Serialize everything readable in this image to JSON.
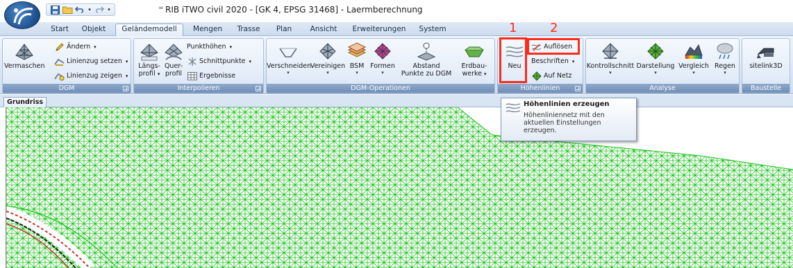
{
  "window": {
    "title": "RIB iTWO civil 2020 - [GK 4, EPSG 31468] - Laermberechnung",
    "qat_separator": "="
  },
  "tabs": [
    {
      "label": "Start"
    },
    {
      "label": "Objekt"
    },
    {
      "label": "Geländemodell",
      "active": true
    },
    {
      "label": "Mengen"
    },
    {
      "label": "Trasse"
    },
    {
      "label": "Plan"
    },
    {
      "label": "Ansicht"
    },
    {
      "label": "Erweiterungen"
    },
    {
      "label": "System"
    }
  ],
  "ribbon": {
    "dgm": {
      "label": "DGM",
      "vermaschen": "Vermaschen",
      "aendern": "Ändern",
      "linienzug_setzen": "Linienzug setzen",
      "linienzug_zeigen": "Linienzug zeigen"
    },
    "interpolieren": {
      "label": "Interpolieren",
      "laengs_line1": "Längs-",
      "laengs_line2": "profil",
      "quer_line1": "Quer-",
      "quer_line2": "profil",
      "punkthoehen": "Punkthöhen",
      "schnittpunkte": "Schnittpunkte",
      "ergebnisse": "Ergebnisse"
    },
    "dgm_operationen": {
      "label": "DGM-Operationen",
      "verschneiden": "Verschneiden",
      "vereinigen": "Vereinigen",
      "bsm": "BSM",
      "formen": "Formen",
      "abstand_line1": "Abstand",
      "abstand_line2": "Punkte zu DGM",
      "erdbau_line1": "Erdbau-",
      "erdbau_line2": "werke"
    },
    "hoehenlinien": {
      "label": "Höhenlinien",
      "neu": "Neu",
      "aufloesen": "Auflösen",
      "beschriften": "Beschriften",
      "auf_netz": "Auf Netz"
    },
    "analyse": {
      "label": "Analyse",
      "kontrollschnitt": "Kontrollschnitt",
      "darstellung": "Darstellung",
      "vergleich": "Vergleich",
      "regen": "Regen"
    },
    "baustelle": {
      "label": "Baustelle",
      "sitelink": "sitelink3D"
    }
  },
  "annotations": {
    "num1": "1",
    "num2": "2",
    "color": "#ff2a1a"
  },
  "tooltip": {
    "title": "Höhenlinien erzeugen",
    "body": "Höhenliniennetz mit den aktuellen Einstellungen erzeugen."
  },
  "document": {
    "tab": "Grundriss"
  },
  "colors": {
    "mesh": "#17c317",
    "ribbon_label_bg": "#7c97bd"
  }
}
